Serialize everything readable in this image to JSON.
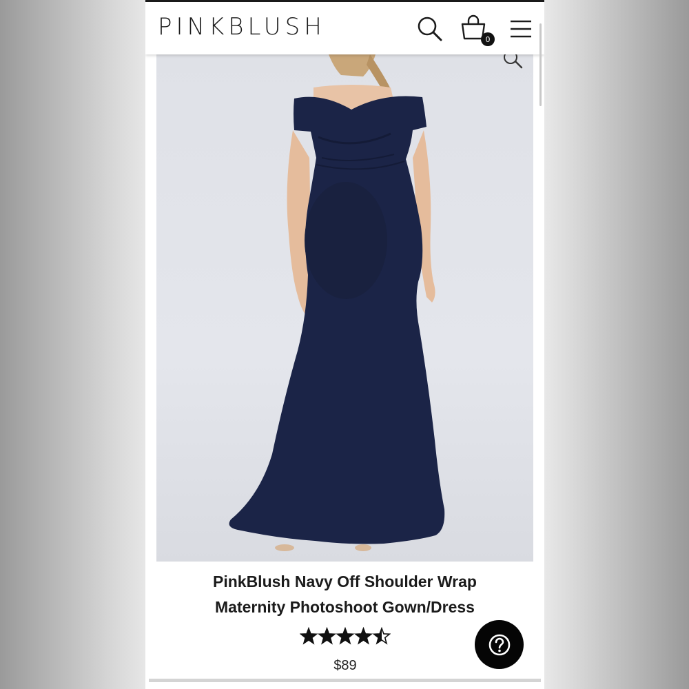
{
  "header": {
    "logo": "PINKBLUSH",
    "cart_count": "0",
    "icons": [
      "search-icon",
      "shopping-bag-icon",
      "hamburger-menu-icon"
    ]
  },
  "product": {
    "image_alt": "Navy off shoulder wrap maternity gown",
    "title_line1": "PinkBlush Navy Off Shoulder Wrap",
    "title_line2": "Maternity Photoshoot Gown/Dress",
    "rating": 4.5,
    "rating_max": 5,
    "price": "$89"
  },
  "help": {
    "icon": "question-icon"
  },
  "colors": {
    "dress": "#1b2447",
    "background": "#e1e3e9",
    "text": "#1b1b1b"
  }
}
